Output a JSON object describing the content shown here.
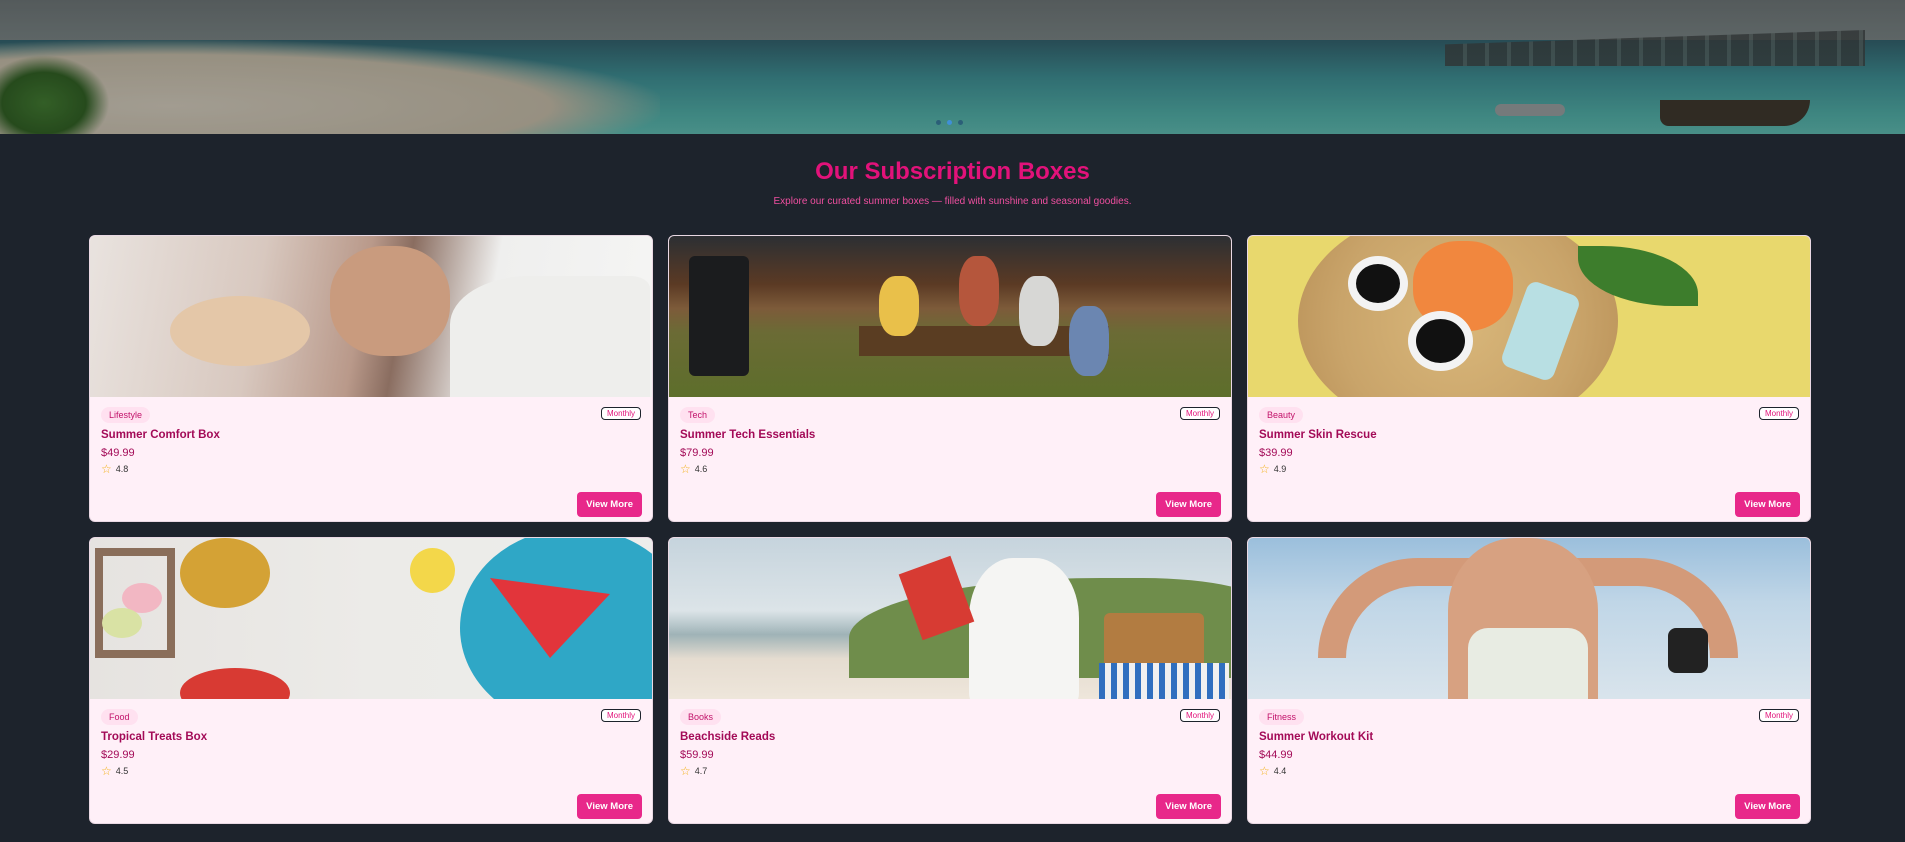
{
  "hero": {
    "slides": 3,
    "active_slide": 2
  },
  "section": {
    "title": "Our Subscription Boxes",
    "subtitle": "Explore our curated summer boxes — filled with sunshine and seasonal goodies."
  },
  "cards": [
    {
      "category": "Lifestyle",
      "frequency": "Monthly",
      "name": "Summer Comfort Box",
      "price": "$49.99",
      "rating": "4.8",
      "button": "View More"
    },
    {
      "category": "Tech",
      "frequency": "Monthly",
      "name": "Summer Tech Essentials",
      "price": "$79.99",
      "rating": "4.6",
      "button": "View More"
    },
    {
      "category": "Beauty",
      "frequency": "Monthly",
      "name": "Summer Skin Rescue",
      "price": "$39.99",
      "rating": "4.9",
      "button": "View More"
    },
    {
      "category": "Food",
      "frequency": "Monthly",
      "name": "Tropical Treats Box",
      "price": "$29.99",
      "rating": "4.5",
      "button": "View More"
    },
    {
      "category": "Books",
      "frequency": "Monthly",
      "name": "Beachside Reads",
      "price": "$59.99",
      "rating": "4.7",
      "button": "View More"
    },
    {
      "category": "Fitness",
      "frequency": "Monthly",
      "name": "Summer Workout Kit",
      "price": "$44.99",
      "rating": "4.4",
      "button": "View More"
    }
  ],
  "icons": {
    "rating": "star-icon"
  },
  "colors": {
    "accent": "#e8288a",
    "title": "#e2127a",
    "card_bg": "#fff0f8",
    "page_bg": "#1d232c"
  }
}
